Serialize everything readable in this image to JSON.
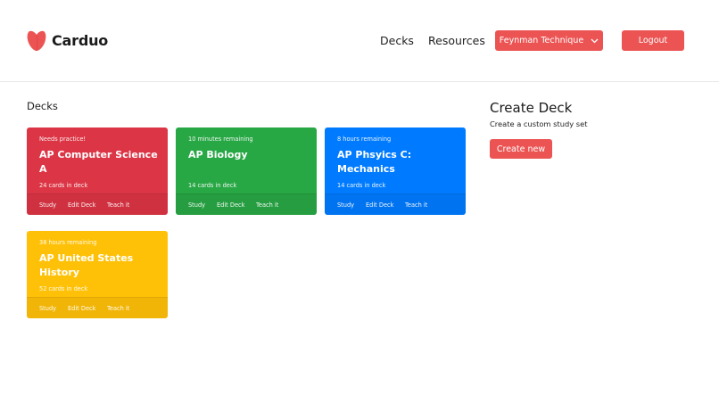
{
  "header": {
    "brand": "Carduo",
    "nav": {
      "decks": "Decks",
      "resources": "Resources"
    },
    "dropdown_label": "Feynman Technique",
    "logout_label": "Logout"
  },
  "main": {
    "section_title": "Decks"
  },
  "decks": [
    {
      "status": "Needs practice!",
      "title": "AP Computer Science A",
      "count": "24 cards in deck",
      "color": "#dc3545"
    },
    {
      "status": "10 minutes remaining",
      "title": "AP Biology",
      "count": "14 cards in deck",
      "color": "#28a745"
    },
    {
      "status": "8 hours remaining",
      "title": "AP Phsyics C: Mechanics",
      "count": "14 cards in deck",
      "color": "#007bff"
    },
    {
      "status": "38 hours remaining",
      "title": "AP United States History",
      "count": "52 cards in deck",
      "color": "#ffc107"
    }
  ],
  "card_actions": {
    "study": "Study",
    "edit": "Edit Deck",
    "teach": "Teach it"
  },
  "create": {
    "title": "Create Deck",
    "subtitle": "Create a custom study set",
    "button": "Create new"
  },
  "colors": {
    "accent": "#ec5454",
    "logo": "#ec5454"
  },
  "icons": {
    "logo": "heart-logo-icon",
    "dropdown": "chevron-down-icon"
  }
}
